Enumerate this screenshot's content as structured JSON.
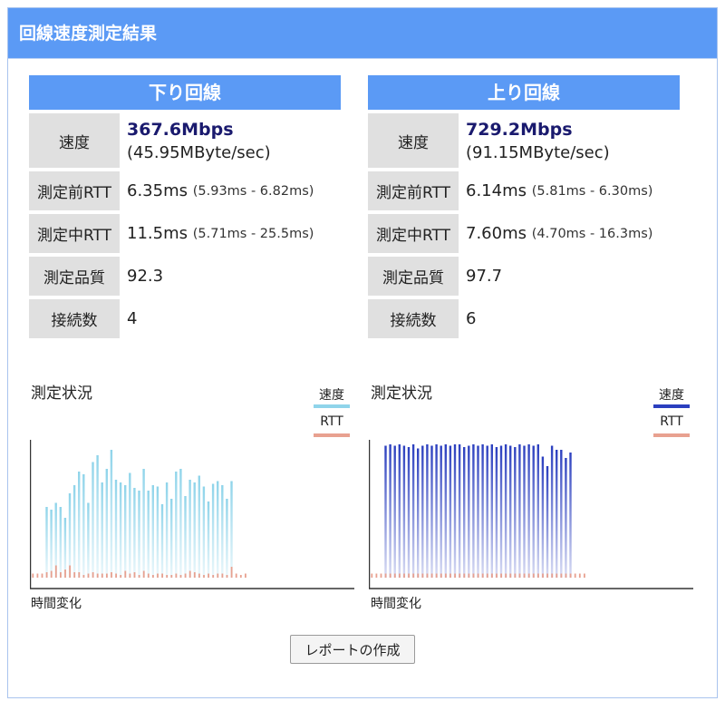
{
  "header": {
    "title": "回線速度測定結果"
  },
  "download": {
    "title": "下り回線",
    "speed_label": "速度",
    "speed_mbps": "367.6Mbps",
    "speed_mbyte": "(45.95MByte/sec)",
    "rtt_before_label": "測定前RTT",
    "rtt_before": "6.35ms",
    "rtt_before_range": "(5.93ms - 6.82ms)",
    "rtt_during_label": "測定中RTT",
    "rtt_during": "11.5ms",
    "rtt_during_range": "(5.71ms - 25.5ms)",
    "quality_label": "測定品質",
    "quality": "92.3",
    "connections_label": "接続数",
    "connections": "4",
    "chart_title": "測定状況",
    "legend_speed": "速度",
    "legend_rtt": "RTT",
    "x_label": "時間変化",
    "speed_color": "#8fd4ea",
    "rtt_color": "#e8a190"
  },
  "upload": {
    "title": "上り回線",
    "speed_label": "速度",
    "speed_mbps": "729.2Mbps",
    "speed_mbyte": "(91.15MByte/sec)",
    "rtt_before_label": "測定前RTT",
    "rtt_before": "6.14ms",
    "rtt_before_range": "(5.81ms - 6.30ms)",
    "rtt_during_label": "測定中RTT",
    "rtt_during": "7.60ms",
    "rtt_during_range": "(4.70ms - 16.3ms)",
    "quality_label": "測定品質",
    "quality": "97.7",
    "connections_label": "接続数",
    "connections": "6",
    "chart_title": "測定状況",
    "legend_speed": "速度",
    "legend_rtt": "RTT",
    "x_label": "時間変化",
    "speed_color": "#2b3fbf",
    "rtt_color": "#e8a190"
  },
  "report_button": {
    "label": "レポートの作成"
  },
  "chart_data": [
    {
      "type": "bar",
      "series": [
        {
          "name": "速度",
          "values": [
            0,
            0,
            0,
            52,
            50,
            55,
            52,
            44,
            62,
            68,
            78,
            76,
            55,
            85,
            90,
            70,
            80,
            94,
            72,
            70,
            68,
            77,
            66,
            64,
            80,
            64,
            68,
            67,
            54,
            70,
            58,
            78,
            80,
            60,
            72,
            70,
            75,
            67,
            56,
            69,
            71,
            68,
            58,
            71,
            0,
            0,
            0
          ]
        },
        {
          "name": "RTT",
          "values": [
            3,
            3,
            3,
            4,
            5,
            9,
            4,
            6,
            9,
            4,
            4,
            2,
            3,
            4,
            3,
            3,
            3,
            4,
            3,
            2,
            5,
            3,
            4,
            2,
            5,
            3,
            2,
            3,
            3,
            2,
            2,
            3,
            2,
            3,
            5,
            4,
            3,
            2,
            3,
            2,
            3,
            3,
            2,
            8,
            3,
            2,
            3
          ]
        }
      ]
    },
    {
      "type": "bar",
      "series": [
        {
          "name": "速度",
          "values": [
            0,
            0,
            0,
            97,
            98,
            97,
            98,
            97,
            96,
            98,
            95,
            97,
            98,
            97,
            98,
            97,
            98,
            97,
            98,
            98,
            96,
            97,
            98,
            97,
            98,
            97,
            98,
            96,
            97,
            98,
            97,
            96,
            98,
            97,
            98,
            97,
            98,
            89,
            82,
            97,
            94,
            94,
            88,
            92,
            0,
            0,
            0
          ]
        },
        {
          "name": "RTT",
          "values": [
            3,
            3,
            3,
            3,
            3,
            3,
            3,
            3,
            3,
            3,
            3,
            3,
            3,
            3,
            3,
            3,
            3,
            3,
            3,
            3,
            3,
            3,
            3,
            3,
            3,
            3,
            3,
            3,
            3,
            3,
            3,
            3,
            3,
            3,
            3,
            3,
            3,
            3,
            3,
            3,
            3,
            3,
            3,
            3,
            3,
            3,
            3
          ]
        }
      ]
    }
  ]
}
